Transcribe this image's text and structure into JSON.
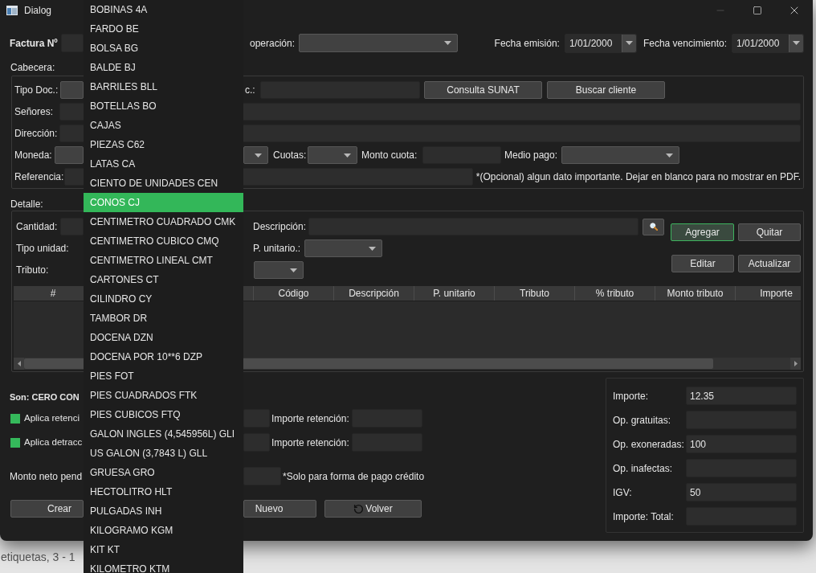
{
  "window": {
    "title": "Dialog"
  },
  "invoice": {
    "number_label": "Factura Nº",
    "operation_type_label": "operación:",
    "issue_date_label": "Fecha emisión:",
    "issue_date": "1/01/2000",
    "due_date_label": "Fecha vencimiento:",
    "due_date": "1/01/2000"
  },
  "header_section": {
    "title": "Cabecera:",
    "doc_type_label": "Tipo Doc.:",
    "doc_number_label": "c.:",
    "sunat_button": "Consulta SUNAT",
    "find_customer_button": "Buscar cliente",
    "customer_label": "Señores:",
    "address_label": "Dirección:",
    "currency_label": "Moneda:",
    "installments_label": "Cuotas:",
    "installment_amount_label": "Monto cuota:",
    "payment_method_label": "Medio pago:",
    "reference_label": "Referencia:",
    "reference_note": "*(Opcional) algun dato importante. Dejar en blanco para no mostrar en PDF."
  },
  "detail_section": {
    "title": "Detalle:",
    "quantity_label": "Cantidad:",
    "unit_type_label": "Tipo unidad:",
    "tax_label": "Tributo:",
    "description_label": "Descripción:",
    "unit_price_label": "P. unitario.:",
    "buttons": [
      {
        "label": "Agregar",
        "focused": true
      },
      {
        "label": "Quitar",
        "focused": false
      },
      {
        "label": "Editar",
        "focused": false
      },
      {
        "label": "Actualizar",
        "focused": false
      }
    ],
    "table": {
      "columns": [
        "#",
        "Código",
        "Descripción",
        "P. unitario",
        "Tributo",
        "% tributo",
        "Monto tributo",
        "Importe"
      ]
    }
  },
  "summary": {
    "amount_in_words": "Son: CERO CON",
    "options": [
      {
        "label": "Aplica retenci",
        "checked": true,
        "amount_label": "Importe retención:"
      },
      {
        "label": "Aplica detracc",
        "checked": true,
        "amount_label": "Importe retención:"
      }
    ],
    "net_pending_label": "Monto neto pend",
    "credit_note": "*Solo para forma de pago crédito",
    "create_button": "Crear",
    "new_button": "Nuevo",
    "back_button": "Volver"
  },
  "totals": [
    {
      "label": "Importe:",
      "value": "12.35"
    },
    {
      "label": "Op. gratuitas:"
    },
    {
      "label": "Op. exoneradas:",
      "value": "100"
    },
    {
      "label": "Op. inafectas:"
    },
    {
      "label": "IGV:",
      "value": "50"
    },
    {
      "label": "Importe: Total:"
    }
  ],
  "unit_dropdown": {
    "options": [
      {
        "label": "BOBINAS 4A",
        "selected": false
      },
      {
        "label": "FARDO BE",
        "selected": false
      },
      {
        "label": "BOLSA BG",
        "selected": false
      },
      {
        "label": "BALDE BJ",
        "selected": false
      },
      {
        "label": "BARRILES BLL",
        "selected": false
      },
      {
        "label": "BOTELLAS BO",
        "selected": false
      },
      {
        "label": "CAJAS",
        "selected": false
      },
      {
        "label": "PIEZAS C62",
        "selected": false
      },
      {
        "label": "LATAS CA",
        "selected": false
      },
      {
        "label": "CIENTO DE UNIDADES CEN",
        "selected": false
      },
      {
        "label": "CONOS CJ",
        "selected": true
      },
      {
        "label": "CENTIMETRO CUADRADO CMK",
        "selected": false
      },
      {
        "label": "CENTIMETRO CUBICO CMQ",
        "selected": false
      },
      {
        "label": "CENTIMETRO LINEAL CMT",
        "selected": false
      },
      {
        "label": "CARTONES CT",
        "selected": false
      },
      {
        "label": "CILINDRO CY",
        "selected": false
      },
      {
        "label": "TAMBOR DR",
        "selected": false
      },
      {
        "label": "DOCENA DZN",
        "selected": false
      },
      {
        "label": "DOCENA POR 10**6 DZP",
        "selected": false
      },
      {
        "label": "PIES FOT",
        "selected": false
      },
      {
        "label": "PIES CUADRADOS FTK",
        "selected": false
      },
      {
        "label": "PIES CUBICOS FTQ",
        "selected": false
      },
      {
        "label": "GALON INGLES (4,545956L) GLI",
        "selected": false
      },
      {
        "label": "US GALON (3,7843 L) GLL",
        "selected": false
      },
      {
        "label": "GRUESA GRO",
        "selected": false
      },
      {
        "label": "HECTOLITRO HLT",
        "selected": false
      },
      {
        "label": "PULGADAS INH",
        "selected": false
      },
      {
        "label": "KILOGRAMO KGM",
        "selected": false
      },
      {
        "label": "KIT KT",
        "selected": false
      },
      {
        "label": "KILOMETRO KTM",
        "selected": false
      }
    ]
  },
  "background": {
    "text": "etiquetas, 3 - 1"
  }
}
